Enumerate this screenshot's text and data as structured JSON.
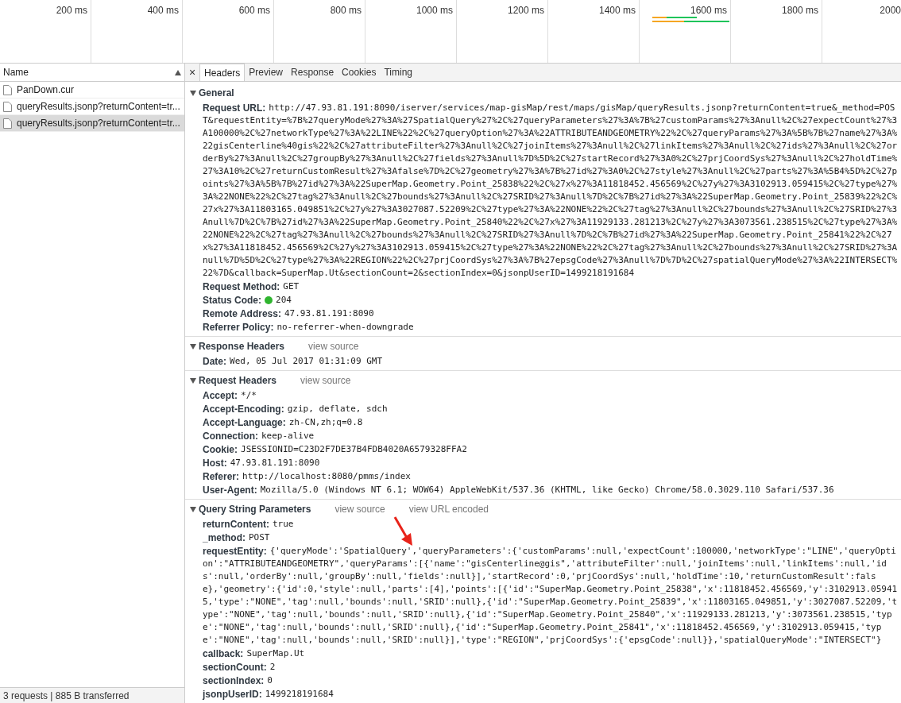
{
  "timeline": {
    "ticks": [
      "200 ms",
      "400 ms",
      "600 ms",
      "800 ms",
      "1000 ms",
      "1200 ms",
      "1400 ms",
      "1600 ms",
      "1800 ms",
      "2000"
    ]
  },
  "requests": {
    "column": "Name",
    "items": [
      {
        "name": "PanDown.cur",
        "selected": false
      },
      {
        "name": "queryResults.jsonp?returnContent=tr...",
        "selected": false
      },
      {
        "name": "queryResults.jsonp?returnContent=tr...",
        "selected": true
      }
    ]
  },
  "status_bar": "3 requests | 885 B transferred",
  "close": "×",
  "tabs": [
    {
      "label": "Headers",
      "selected": true
    },
    {
      "label": "Preview",
      "selected": false
    },
    {
      "label": "Response",
      "selected": false
    },
    {
      "label": "Cookies",
      "selected": false
    },
    {
      "label": "Timing",
      "selected": false
    }
  ],
  "sections": [
    {
      "title": "General",
      "expanded": true,
      "rows": [
        {
          "key": "Request URL:",
          "value": "http://47.93.81.191:8090/iserver/services/map-gisMap/rest/maps/gisMap/queryResults.jsonp?returnContent=true&_method=POST&requestEntity=%7B%27queryMode%27%3A%27SpatialQuery%27%2C%27queryParameters%27%3A%7B%27customParams%27%3Anull%2C%27expectCount%27%3A100000%2C%27networkType%27%3A%22LINE%22%2C%27queryOption%27%3A%22ATTRIBUTEANDGEOMETRY%22%2C%27queryParams%27%3A%5B%7B%27name%27%3A%22gisCenterline%40gis%22%2C%27attributeFilter%27%3Anull%2C%27joinItems%27%3Anull%2C%27linkItems%27%3Anull%2C%27ids%27%3Anull%2C%27orderBy%27%3Anull%2C%27groupBy%27%3Anull%2C%27fields%27%3Anull%7D%5D%2C%27startRecord%27%3A0%2C%27prjCoordSys%27%3Anull%2C%27holdTime%27%3A10%2C%27returnCustomResult%27%3Afalse%7D%2C%27geometry%27%3A%7B%27id%27%3A0%2C%27style%27%3Anull%2C%27parts%27%3A%5B4%5D%2C%27points%27%3A%5B%7B%27id%27%3A%22SuperMap.Geometry.Point_25838%22%2C%27x%27%3A11818452.456569%2C%27y%27%3A3102913.059415%2C%27type%27%3A%22NONE%22%2C%27tag%27%3Anull%2C%27bounds%27%3Anull%2C%27SRID%27%3Anull%7D%2C%7B%27id%27%3A%22SuperMap.Geometry.Point_25839%22%2C%27x%27%3A11803165.049851%2C%27y%27%3A3027087.52209%2C%27type%27%3A%22NONE%22%2C%27tag%27%3Anull%2C%27bounds%27%3Anull%2C%27SRID%27%3Anull%7D%2C%7B%27id%27%3A%22SuperMap.Geometry.Point_25840%22%2C%27x%27%3A11929133.281213%2C%27y%27%3A3073561.238515%2C%27type%27%3A%22NONE%22%2C%27tag%27%3Anull%2C%27bounds%27%3Anull%2C%27SRID%27%3Anull%7D%2C%7B%27id%27%3A%22SuperMap.Geometry.Point_25841%22%2C%27x%27%3A11818452.456569%2C%27y%27%3A3102913.059415%2C%27type%27%3A%22NONE%22%2C%27tag%27%3Anull%2C%27bounds%27%3Anull%2C%27SRID%27%3Anull%7D%5D%2C%27type%27%3A%22REGION%22%2C%27prjCoordSys%27%3A%7B%27epsgCode%27%3Anull%7D%7D%2C%27spatialQueryMode%27%3A%22INTERSECT%22%7D&callback=SuperMap.Ut&sectionCount=2&sectionIndex=0&jsonpUserID=1499218191684",
          "kind": "text"
        },
        {
          "key": "Request Method:",
          "value": "GET",
          "kind": "text"
        },
        {
          "key": "Status Code:",
          "value": "204",
          "kind": "status"
        },
        {
          "key": "Remote Address:",
          "value": "47.93.81.191:8090",
          "kind": "text"
        },
        {
          "key": "Referrer Policy:",
          "value": "no-referrer-when-downgrade",
          "kind": "text"
        }
      ]
    },
    {
      "title": "Response Headers",
      "expanded": true,
      "links": [
        "view source"
      ],
      "rows": [
        {
          "key": "Date:",
          "value": "Wed, 05 Jul 2017 01:31:09 GMT",
          "kind": "text"
        }
      ]
    },
    {
      "title": "Request Headers",
      "expanded": true,
      "links": [
        "view source"
      ],
      "rows": [
        {
          "key": "Accept:",
          "value": "*/*",
          "kind": "text"
        },
        {
          "key": "Accept-Encoding:",
          "value": "gzip, deflate, sdch",
          "kind": "text"
        },
        {
          "key": "Accept-Language:",
          "value": "zh-CN,zh;q=0.8",
          "kind": "text"
        },
        {
          "key": "Connection:",
          "value": "keep-alive",
          "kind": "text"
        },
        {
          "key": "Cookie:",
          "value": "JSESSIONID=C23D2F7DE37B4FDB4020A6579328FFA2",
          "kind": "text"
        },
        {
          "key": "Host:",
          "value": "47.93.81.191:8090",
          "kind": "text"
        },
        {
          "key": "Referer:",
          "value": "http://localhost:8080/pmms/index",
          "kind": "text"
        },
        {
          "key": "User-Agent:",
          "value": "Mozilla/5.0 (Windows NT 6.1; WOW64) AppleWebKit/537.36 (KHTML, like Gecko) Chrome/58.0.3029.110 Safari/537.36",
          "kind": "text"
        }
      ]
    },
    {
      "title": "Query String Parameters",
      "expanded": true,
      "links": [
        "view source",
        "view URL encoded"
      ],
      "rows": [
        {
          "key": "returnContent:",
          "value": "true",
          "kind": "text"
        },
        {
          "key": "_method:",
          "value": "POST",
          "kind": "text"
        },
        {
          "key": "requestEntity:",
          "value": "{'queryMode':'SpatialQuery','queryParameters':{'customParams':null,'expectCount':100000,'networkType':\"LINE\",'queryOption':\"ATTRIBUTEANDGEOMETRY\",'queryParams':[{'name':\"gisCenterline@gis\",'attributeFilter':null,'joinItems':null,'linkItems':null,'ids':null,'orderBy':null,'groupBy':null,'fields':null}],'startRecord':0,'prjCoordSys':null,'holdTime':10,'returnCustomResult':false},'geometry':{'id':0,'style':null,'parts':[4],'points':[{'id':\"SuperMap.Geometry.Point_25838\",'x':11818452.456569,'y':3102913.059415,'type':\"NONE\",'tag':null,'bounds':null,'SRID':null},{'id':\"SuperMap.Geometry.Point_25839\",'x':11803165.049851,'y':3027087.52209,'type':\"NONE\",'tag':null,'bounds':null,'SRID':null},{'id':\"SuperMap.Geometry.Point_25840\",'x':11929133.281213,'y':3073561.238515,'type':\"NONE\",'tag':null,'bounds':null,'SRID':null},{'id':\"SuperMap.Geometry.Point_25841\",'x':11818452.456569,'y':3102913.059415,'type':\"NONE\",'tag':null,'bounds':null,'SRID':null}],'type':\"REGION\",'prjCoordSys':{'epsgCode':null}},'spatialQueryMode':\"INTERSECT\"}",
          "kind": "text"
        },
        {
          "key": "callback:",
          "value": "SuperMap.Ut",
          "kind": "text"
        },
        {
          "key": "sectionCount:",
          "value": "2",
          "kind": "text"
        },
        {
          "key": "sectionIndex:",
          "value": "0",
          "kind": "text"
        },
        {
          "key": "jsonpUserID:",
          "value": "1499218191684",
          "kind": "text"
        }
      ]
    }
  ]
}
